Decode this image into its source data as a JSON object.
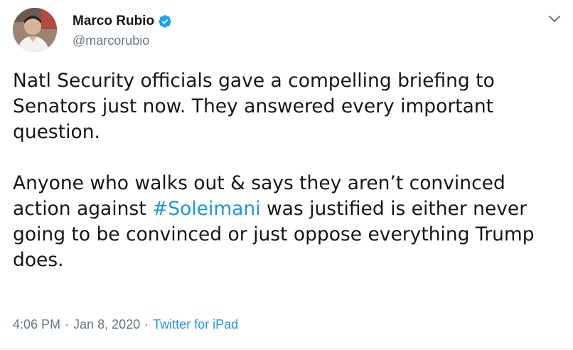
{
  "author": {
    "display_name": "Marco Rubio",
    "handle": "@marcorubio",
    "verified": true,
    "avatar_icon": "avatar-photo"
  },
  "tweet": {
    "paragraph1": "Natl Security officials gave a compelling briefing to Senators just now. They answered every important question.",
    "paragraph2_before": "Anyone who walks out & says they aren’t convinced action against ",
    "hashtag": "#Soleimani",
    "paragraph2_after": " was justified is either never going to be convinced or just oppose everything Trump does."
  },
  "meta": {
    "time": "4:06 PM",
    "separator1": "·",
    "date": "Jan 8, 2020",
    "separator2": "·",
    "source": "Twitter for iPad"
  },
  "colors": {
    "link": "#1b95e0",
    "secondary_text": "#657786",
    "verified_badge": "#1da1f2"
  },
  "icons": {
    "verified": "verified-badge-icon",
    "menu": "chevron-down-icon"
  }
}
